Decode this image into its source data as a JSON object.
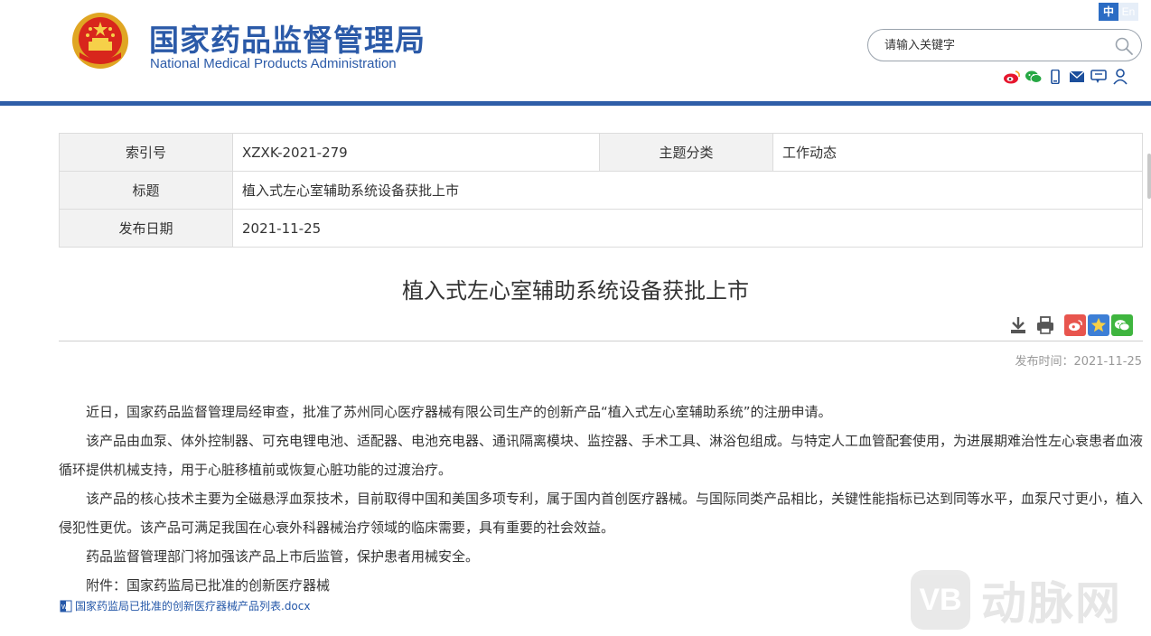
{
  "header": {
    "site_name_cn": "国家药品监督管理局",
    "site_name_en": "National Medical Products Administration",
    "lang_cn": "中",
    "lang_en": "En",
    "search_placeholder": "请输入关键字",
    "brand_color": "#2b5aa8"
  },
  "meta": {
    "index_label": "索引号",
    "index_value": "XZXK-2021-279",
    "category_label": "主题分类",
    "category_value": "工作动态",
    "title_label": "标题",
    "title_value": "植入式左心室辅助系统设备获批上市",
    "date_label": "发布日期",
    "date_value": "2021-11-25"
  },
  "article": {
    "title": "植入式左心室辅助系统设备获批上市",
    "publish_time": "发布时间：2021-11-25",
    "paragraphs": [
      "近日，国家药品监督管理局经审查，批准了苏州同心医疗器械有限公司生产的创新产品“植入式左心室辅助系统”的注册申请。",
      "该产品由血泵、体外控制器、可充电锂电池、适配器、电池充电器、通讯隔离模块、监控器、手术工具、淋浴包组成。与特定人工血管配套使用，为进展期难治性左心衰患者血液循环提供机械支持，用于心脏移植前或恢复心脏功能的过渡治疗。",
      "该产品的核心技术主要为全磁悬浮血泵技术，目前取得中国和美国多项专利，属于国内首创医疗器械。与国际同类产品相比，关键性能指标已达到同等水平，血泵尺寸更小，植入侵犯性更优。该产品可满足我国在心衰外科器械治疗领域的临床需要，具有重要的社会效益。",
      "药品监督管理部门将加强该产品上市后监管，保护患者用械安全。",
      "附件：国家药监局已批准的创新医疗器械"
    ],
    "attachment_link": "国家药监局已批准的创新医疗器械产品列表.docx"
  },
  "watermark": {
    "logo_text": "VB",
    "text": "动脉网"
  }
}
